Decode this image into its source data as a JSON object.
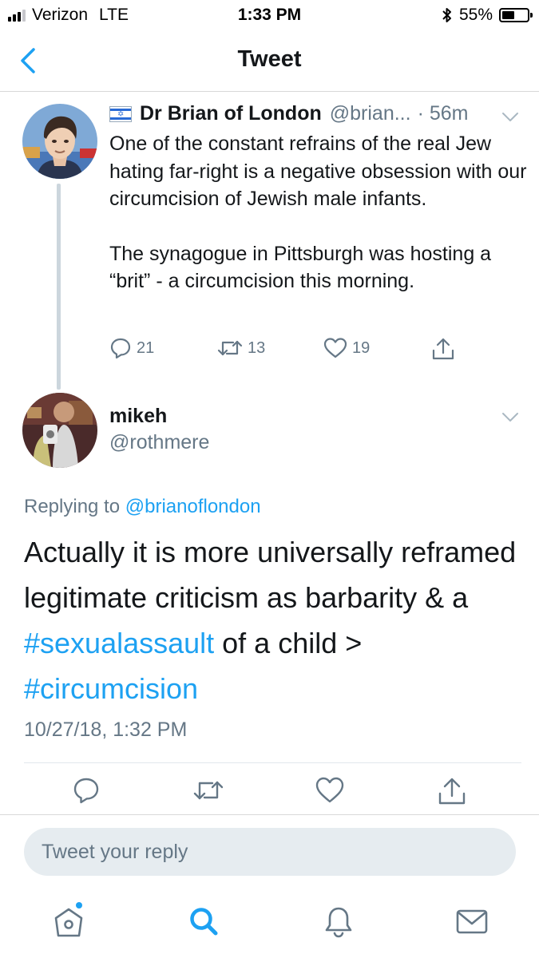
{
  "status_bar": {
    "carrier": "Verizon",
    "network": "LTE",
    "time": "1:33 PM",
    "battery_percent": "55%",
    "battery_level": 0.55,
    "icons": [
      "signal-bars-icon",
      "bluetooth-icon",
      "battery-icon"
    ]
  },
  "nav": {
    "title": "Tweet",
    "back_icon": "chevron-left-icon"
  },
  "parent_tweet": {
    "display_name": "Dr Brian of London",
    "handle": "@brian...",
    "time": "· 56m",
    "flag_icon": "israel-flag-icon",
    "paragraphs": [
      "One of the constant refrains of the real Jew hating far-right is a negative obsession with our circumcision of Jewish male infants.",
      "The synagogue in Pittsburgh was hosting a “brit” - a circumcision this morning."
    ],
    "actions": {
      "replies": "21",
      "retweets": "13",
      "likes": "19"
    }
  },
  "focused_tweet": {
    "display_name": "mikeh",
    "handle": "@rothmere",
    "replying_prefix": "Replying to",
    "replying_to": "@brianoflondon",
    "text_part1": "Actually it is more universally reframed legitimate criticism as barbarity & a ",
    "hashtag1": "#sexualassault",
    "text_part2": " of a child > ",
    "hashtag2": "#circumcision",
    "timestamp": "10/27/18, 1:32 PM"
  },
  "reply_box": {
    "placeholder": "Tweet your reply"
  },
  "tab_bar": {
    "items": [
      "home-icon",
      "search-icon",
      "notifications-bell-icon",
      "messages-envelope-icon"
    ],
    "active": "search-icon",
    "home_has_notification_dot": true
  },
  "colors": {
    "accent": "#1da1f2",
    "secondary_text": "#657786",
    "primary_text": "#14171a",
    "divider": "#e1e8ed",
    "reply_field_bg": "#e6ecf0",
    "thread_line": "#ccd6dd"
  }
}
